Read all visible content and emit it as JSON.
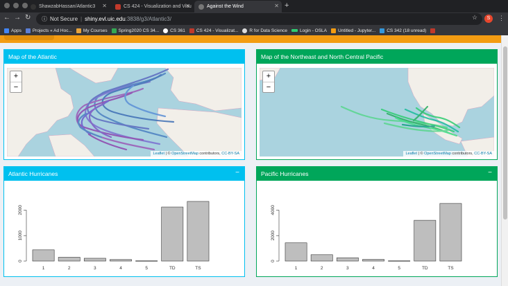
{
  "browser": {
    "tabs": [
      {
        "title": "ShawzabHassan/Atlantic3",
        "active": false
      },
      {
        "title": "CS 424 - Visualization and Visu",
        "active": false
      },
      {
        "title": "Against the Wind",
        "active": true
      }
    ],
    "security_label": "Not Secure",
    "url_host": "shiny.evl.uic.edu",
    "url_rest": ":3838/g3/Atlantic3/",
    "account_initial": "S",
    "bookmarks": [
      "Apps",
      "Projects « Ad Hoc...",
      "My Courses",
      "Spring2020 CS 34...",
      "CS 361",
      "CS 424 - Visualizat...",
      "R for Data Science",
      "Login - OSLA",
      "Untitled - Jupyter...",
      "CS 342 (18 unread)"
    ]
  },
  "panels": {
    "atlantic_map": {
      "title": "Map of the Atlantic",
      "zoom_in": "+",
      "zoom_out": "−"
    },
    "pacific_map": {
      "title": "Map of the Northeast and North Central Pacific",
      "zoom_in": "+",
      "zoom_out": "−"
    },
    "atlantic_chart": {
      "title": "Atlantic Hurricanes",
      "collapse": "−"
    },
    "pacific_chart": {
      "title": "Pacific Hurricanes",
      "collapse": "−"
    }
  },
  "attribution": {
    "leaflet": "Leaflet",
    "sep": " | © ",
    "osm": "OpenStreetMap",
    "contrib": " contributors, ",
    "license": "CC-BY-SA"
  },
  "colors": {
    "atlantic_tracks": [
      "#7b6fd0",
      "#9b59b6",
      "#4a7fc1",
      "#8e44ad"
    ],
    "pacific_tracks": [
      "#2ecc71",
      "#27ae60",
      "#58d68d"
    ],
    "bar_fill": "#bebebe"
  },
  "chart_data": [
    {
      "type": "bar",
      "title": "Atlantic Hurricanes",
      "categories": [
        "1",
        "2",
        "3",
        "4",
        "5",
        "TD",
        "TS"
      ],
      "values": [
        440,
        150,
        110,
        60,
        10,
        2120,
        2340
      ],
      "yticks": [
        0,
        1000,
        2000
      ],
      "ylim": [
        0,
        2500
      ],
      "xlabel": "",
      "ylabel": ""
    },
    {
      "type": "bar",
      "title": "Pacific Hurricanes",
      "categories": [
        "1",
        "2",
        "3",
        "4",
        "5",
        "TD",
        "TS"
      ],
      "values": [
        1430,
        500,
        260,
        130,
        20,
        3200,
        4520
      ],
      "yticks": [
        0,
        2000,
        4000
      ],
      "ylim": [
        0,
        5000
      ],
      "xlabel": "",
      "ylabel": ""
    }
  ]
}
